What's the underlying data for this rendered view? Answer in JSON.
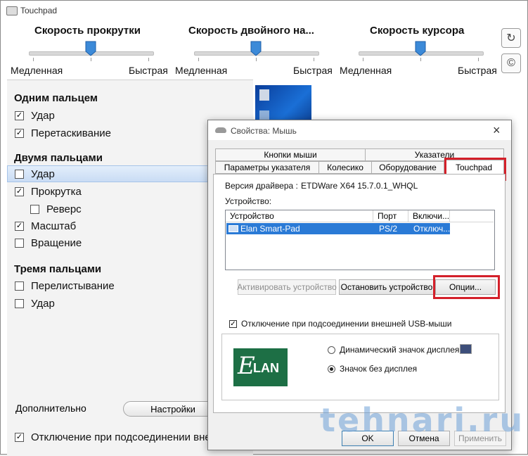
{
  "touchpad_window": {
    "title": "Touchpad",
    "sliders": [
      {
        "title": "Скорость прокрутки",
        "slow": "Медленная",
        "fast": "Быстрая",
        "level": 0.5
      },
      {
        "title": "Скорость двойного на...",
        "slow": "Медленная",
        "fast": "Быстрая",
        "level": 0.5
      },
      {
        "title": "Скорость курсора",
        "slow": "Медленная",
        "fast": "Быстрая",
        "level": 0.5
      }
    ],
    "reset_icon": "↻",
    "copyright_icon": "©",
    "one_finger": {
      "heading": "Одним пальцем",
      "tap": {
        "label": "Удар",
        "checked": true
      },
      "drag": {
        "label": "Перетаскивание",
        "checked": true
      }
    },
    "two_fingers": {
      "heading": "Двумя пальцами",
      "tap": {
        "label": "Удар",
        "checked": false
      },
      "scroll": {
        "label": "Прокрутка",
        "checked": true
      },
      "reverse": {
        "label": "Реверс",
        "checked": false
      },
      "zoom": {
        "label": "Масштаб",
        "checked": true
      },
      "rotate": {
        "label": "Вращение",
        "checked": false
      }
    },
    "three_fingers": {
      "heading": "Тремя пальцами",
      "swipe": {
        "label": "Перелистывание",
        "checked": false
      },
      "tap": {
        "label": "Удар",
        "checked": false
      }
    },
    "additional_label": "Дополнительно",
    "settings_button": "Настройки",
    "usb_disable": {
      "label": "Отключение при подсоединении вне",
      "checked": true
    },
    "check_mark": "✓"
  },
  "mouse_dialog": {
    "title": "Свойства: Мышь",
    "close": "×",
    "tabs_row1": [
      "Кнопки мыши",
      "Указатели"
    ],
    "tabs_row2": [
      "Параметры указателя",
      "Колесико",
      "Оборудование",
      "Touchpad"
    ],
    "driver_version_label": "Версия драйвера :",
    "driver_version_value": "ETDWare X64 15.7.0.1_WHQL",
    "devices_label": "Устройство:",
    "columns": [
      "Устройство",
      "Порт",
      "Включи..."
    ],
    "device_row": {
      "name": "Elan Smart-Pad",
      "port": "PS/2",
      "state": "Отключ..."
    },
    "activate_button": "Активировать устройство",
    "stop_button": "Остановить устройство",
    "options_button": "Опции...",
    "usb_disable": {
      "label": "Отключение при подсоединении внешней USB-мыши",
      "checked": true
    },
    "radio_dynamic": {
      "label": "Динамический значок дисплея",
      "selected": false
    },
    "radio_static": {
      "label": "Значок без дисплея",
      "selected": true
    },
    "logo_text": "LAN",
    "logo_letter": "E",
    "ok": "OK",
    "cancel": "Отмена",
    "apply": "Применить"
  },
  "watermark": "tehnari.ru",
  "colors": {
    "highlight_red": "#d4202a",
    "selection_blue": "#2a7ad6",
    "elan_green": "#1d6f45"
  }
}
